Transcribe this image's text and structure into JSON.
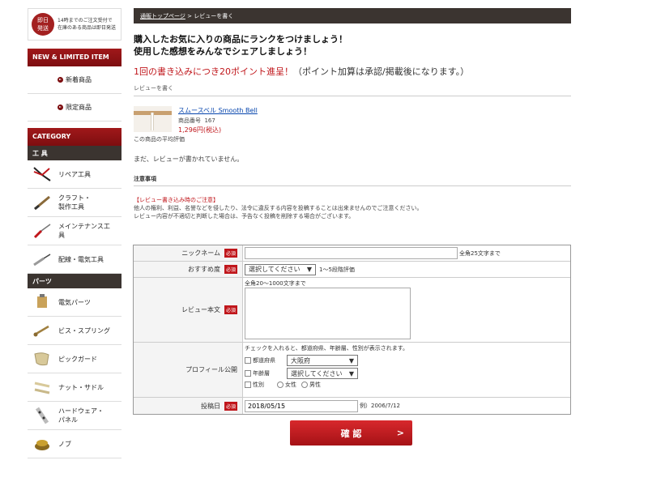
{
  "sidebar": {
    "notice_badge": [
      "即日",
      "発送"
    ],
    "notice_text": [
      "14時までのご注文受付で",
      "在庫のある商品は即日発送"
    ],
    "new_limited_title": "NEW & LIMITED ITEM",
    "new_items": [
      {
        "label": "新着商品"
      },
      {
        "label": "限定商品"
      }
    ],
    "category_title": "CATEGORY",
    "tools_title": "工 具",
    "tools": [
      {
        "label": "リペア工具",
        "icon": "pliers-icon"
      },
      {
        "label": "クラフト・製作工具",
        "icon": "file-tool-icon"
      },
      {
        "label": "メインテナンス工具",
        "icon": "screwdriver-icon"
      },
      {
        "label": "配線・電気工具",
        "icon": "soldering-iron-icon"
      }
    ],
    "parts_title": "パーツ",
    "parts": [
      {
        "label": "電気パーツ",
        "icon": "electric-part-icon"
      },
      {
        "label": "ビス・スプリング",
        "icon": "screw-icon"
      },
      {
        "label": "ピックガード",
        "icon": "pickguard-icon"
      },
      {
        "label": "ナット・サドル",
        "icon": "nut-saddle-icon"
      },
      {
        "label": "ハードウェア・パネル",
        "icon": "hardware-icon"
      },
      {
        "label": "ノブ",
        "icon": "knob-icon"
      }
    ]
  },
  "breadcrumb": {
    "home": "通販トップページ",
    "sep": " > ",
    "current": "レビューを書く"
  },
  "headline": [
    "購入したお気に入りの商品にランクをつけましょう！",
    "使用した感想をみんなでシェアしましょう！"
  ],
  "points": {
    "red": "1回の書き込みにつき20ポイント進呈！",
    "note": "（ポイント加算は承認/掲載後になります。）"
  },
  "sub_title": "レビューを書く",
  "product": {
    "name": "スムースベル Smooth Bell",
    "number_label": "商品番号",
    "number": "167",
    "price": "1,296円(税込)",
    "avg_label": "この商品の平均評価"
  },
  "no_review": "まだ、レビューが書かれていません。",
  "caution_head": "注意事項",
  "caution": {
    "title": "【レビュー書き込み時のご注意】",
    "lines": [
      "他人の権利、利益、名誉などを侵したり、法令に違反する内容を投稿することは出来ませんのでご注意ください。",
      "レビュー内容が不適切と判断した場合は、予告なく投稿を削除する場合がございます。"
    ]
  },
  "form": {
    "required_label": "必須",
    "nickname": {
      "label": "ニックネーム",
      "value": "",
      "hint": "全角25文字まで"
    },
    "rating": {
      "label": "おすすめ度",
      "selected": "選択してください",
      "hint": "1〜5段階評価"
    },
    "review": {
      "label": "レビュー本文",
      "hint": "全角20〜1000文字まで",
      "value": ""
    },
    "profile": {
      "label": "プロフィール公開",
      "hint": "チェックを入れると、都道府県、年齢層、性別が表示されます。",
      "pref_label": "都道府県",
      "pref_value": "大阪府",
      "age_label": "年齢層",
      "age_value": "選択してください",
      "gender_label": "性別",
      "female": "女性",
      "male": "男性"
    },
    "date": {
      "label": "投稿日",
      "value": "2018/05/15",
      "hint": "例）2006/7/12"
    }
  },
  "confirm_label": "確 認",
  "colors": {
    "brand_red": "#c0161b",
    "dark_bar": "#3b3430"
  }
}
